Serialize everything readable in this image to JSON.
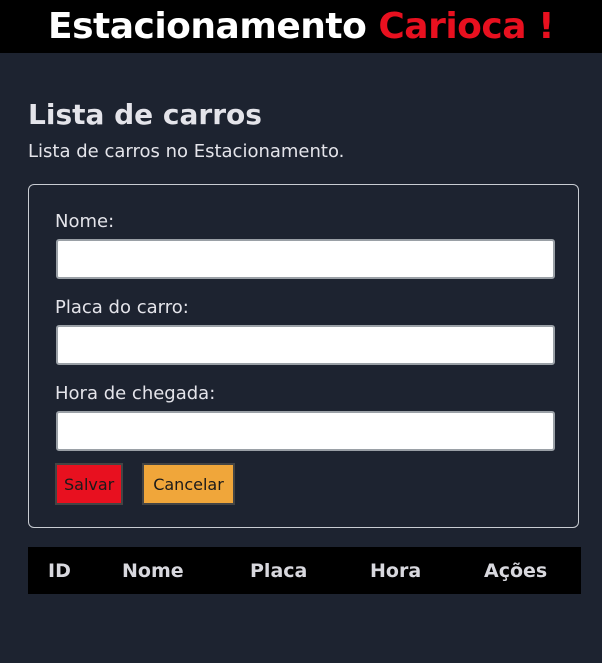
{
  "header": {
    "brand_main": "Estacionamento ",
    "brand_accent": "Carioca !"
  },
  "page": {
    "title": "Lista de carros",
    "subtitle": "Lista de carros no Estacionamento."
  },
  "form": {
    "name_label": "Nome:",
    "name_value": "",
    "plate_label": "Placa do carro:",
    "plate_value": "",
    "arrival_label": "Hora de chegada:",
    "arrival_value": "",
    "save_label": "Salvar",
    "cancel_label": "Cancelar"
  },
  "table": {
    "columns": [
      "ID",
      "Nome",
      "Placa",
      "Hora",
      "Ações"
    ]
  },
  "colors": {
    "accent_red": "#e8101f",
    "cancel_orange": "#f0a63a",
    "background": "#1d2330"
  }
}
